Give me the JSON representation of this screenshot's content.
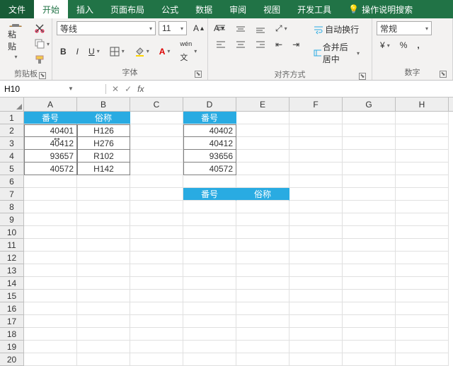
{
  "menu": {
    "file": "文件",
    "home": "开始",
    "insert": "插入",
    "layout": "页面布局",
    "formula": "公式",
    "data": "数据",
    "review": "审阅",
    "view": "视图",
    "dev": "开发工具",
    "help": "操作说明搜索"
  },
  "ribbon": {
    "clipboard": {
      "label": "剪贴板",
      "paste": "粘贴"
    },
    "font": {
      "label": "字体",
      "name": "等线",
      "size": "11"
    },
    "align": {
      "label": "对齐方式",
      "wrap": "自动换行",
      "merge": "合并后居中"
    },
    "number": {
      "label": "数字",
      "format": "常规"
    }
  },
  "namebox": "H10",
  "cols": [
    "A",
    "B",
    "C",
    "D",
    "E",
    "F",
    "G",
    "H"
  ],
  "t1": {
    "h": [
      "番号",
      "俗称"
    ],
    "rows": [
      [
        "40401",
        "H126"
      ],
      [
        "40412",
        "H276"
      ],
      [
        "93657",
        "R102"
      ],
      [
        "40572",
        "H142"
      ]
    ]
  },
  "t2": {
    "h": [
      "番号"
    ],
    "rows": [
      [
        "40402"
      ],
      [
        "40412"
      ],
      [
        "93656"
      ],
      [
        "40572"
      ]
    ]
  },
  "t3": {
    "h": [
      "番号",
      "俗称"
    ]
  },
  "pointer": "↔"
}
